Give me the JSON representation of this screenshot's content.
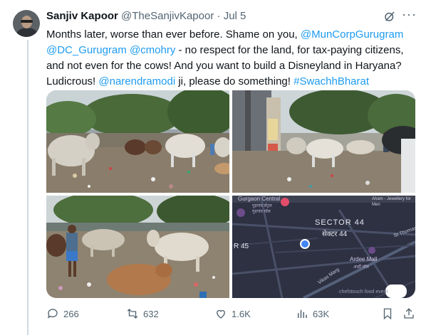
{
  "tweet": {
    "author_name": "Sanjiv Kapoor",
    "author_handle": "@TheSanjivKapoor",
    "separator": "·",
    "date": "Jul 5",
    "text_1": "Months later, worse than ever before. Shame on you, ",
    "mention_1": "@MunCorpGurugram",
    "mention_2": "@DC_Gurugram",
    "mention_3": "@cmohry",
    "text_2": " - no respect for the land, for tax-paying citizens, and not even for the cows! And you want to build a Disneyland in Haryana? Ludicrous! ",
    "mention_4": "@narendramodi",
    "text_3": " ji, please do something! ",
    "hashtag": "#SwachhBharat"
  },
  "map": {
    "place_1": "Gurgaon Central",
    "place_1_hindi": "गुड़गांव सेंट्रल",
    "place_1_sub": "गुडगांव मॉल",
    "place_2": "Aham - Jewellery for Men",
    "sector_label": "SECTOR 44",
    "sector_hindi": "सेक्टर 44",
    "sector_45": "R 45",
    "road_1": "St Thomas",
    "road_2": "Vikas Marg",
    "road_3": "Ardee Mall",
    "road_3_hindi": "आर्डी मॉल",
    "bottom_text": "chefstouch food event"
  },
  "actions": {
    "replies": "266",
    "reposts": "632",
    "likes": "1.6K",
    "views": "63K"
  },
  "colors": {
    "link": "#1d9bf0",
    "muted": "#536471",
    "map_bg": "#2d3142",
    "location_dot": "#4285f4"
  },
  "icons": [
    "reply-icon",
    "repost-icon",
    "like-icon",
    "views-icon",
    "bookmark-icon",
    "share-icon",
    "grok-icon",
    "more-icon"
  ]
}
